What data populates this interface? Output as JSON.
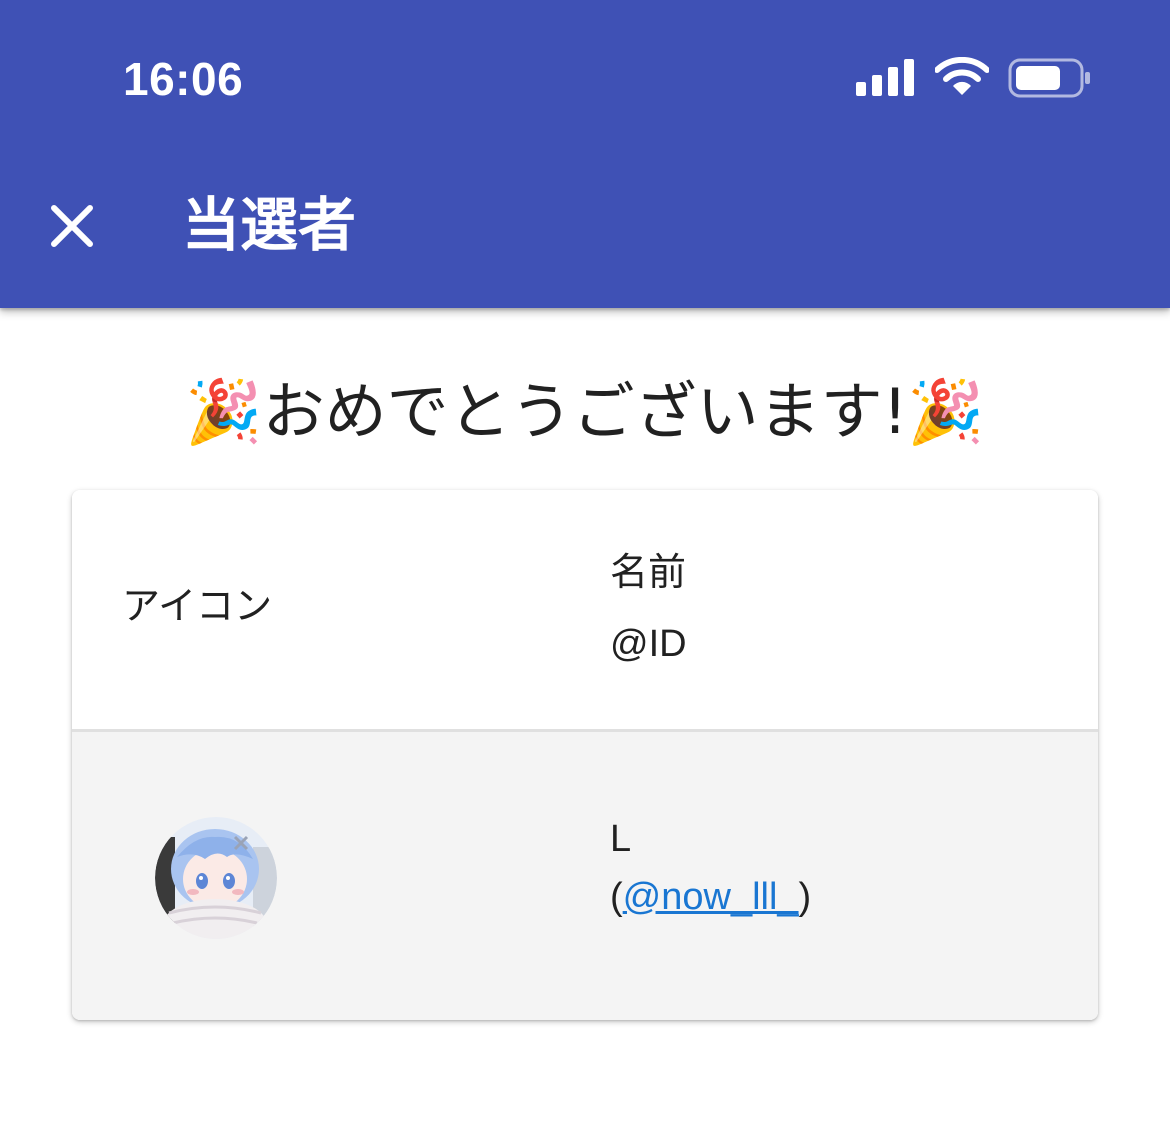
{
  "status_bar": {
    "time": "16:06"
  },
  "toolbar": {
    "close_icon": "close-icon",
    "title": "当選者"
  },
  "colors": {
    "primary": "#3f51b5",
    "link": "#1976d2",
    "row_bg": "#f4f4f4"
  },
  "banner": {
    "party_icon": "🎉",
    "text": "おめでとうございます!"
  },
  "table": {
    "headers": {
      "icon": "アイコン",
      "name": "名前",
      "id": "@ID"
    },
    "rows": [
      {
        "avatar": "avatar",
        "name": "L",
        "paren_open": "(",
        "handle": "@now_lll_",
        "paren_close": ")"
      }
    ]
  }
}
